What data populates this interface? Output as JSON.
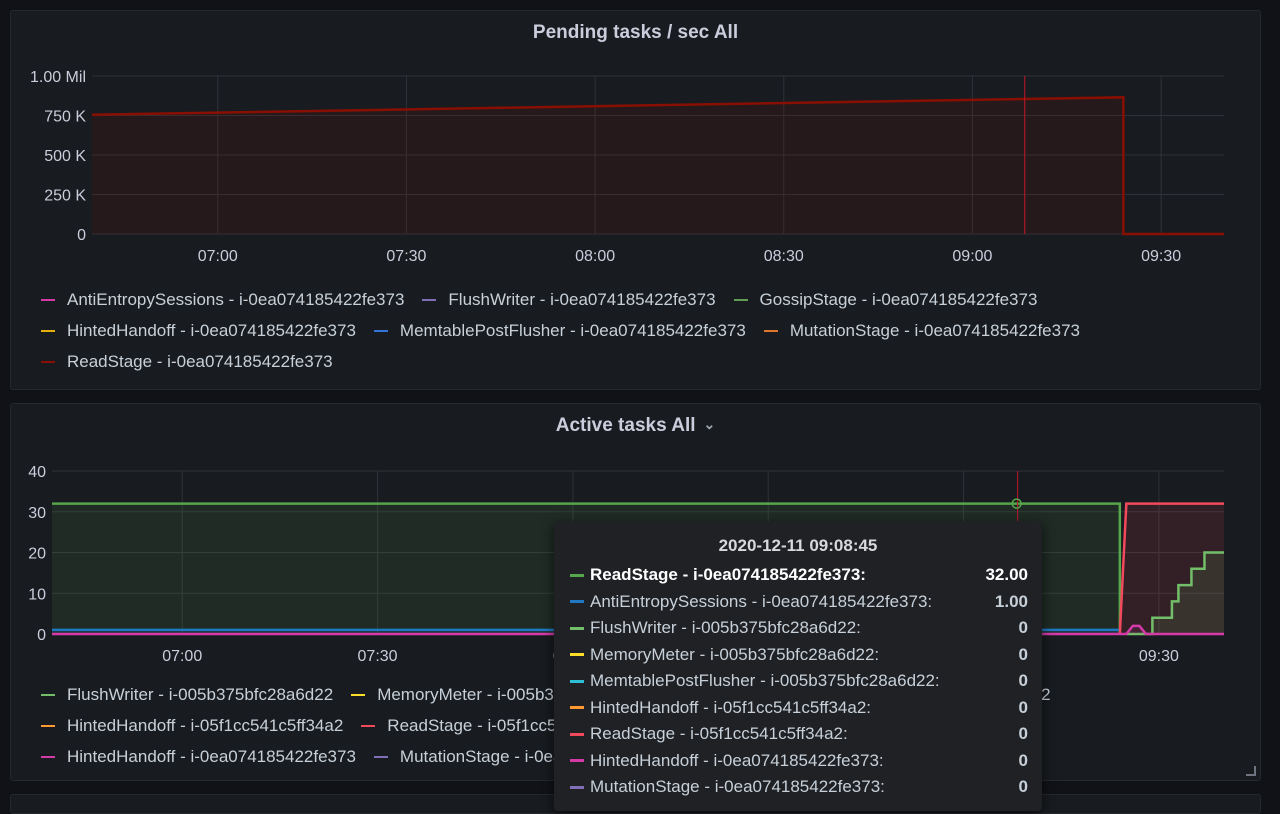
{
  "panel_pending": {
    "title": "Pending tasks / sec All",
    "legend": [
      {
        "label": "AntiEntropySessions - i-0ea074185422fe373",
        "color": "#d63aa9"
      },
      {
        "label": "FlushWriter - i-0ea074185422fe373",
        "color": "#806eb7"
      },
      {
        "label": "GossipStage - i-0ea074185422fe373",
        "color": "#629e51"
      },
      {
        "label": "HintedHandoff - i-0ea074185422fe373",
        "color": "#e5ac0e"
      },
      {
        "label": "MemtablePostFlusher - i-0ea074185422fe373",
        "color": "#3274d9"
      },
      {
        "label": "MutationStage - i-0ea074185422fe373",
        "color": "#e0752d"
      },
      {
        "label": "ReadStage - i-0ea074185422fe373",
        "color": "#890f02"
      }
    ]
  },
  "panel_active": {
    "title": "Active tasks All",
    "legend": [
      {
        "label": "FlushWriter - i-005b375bfc28a6d22",
        "color": "#73bf69"
      },
      {
        "label": "MemoryMeter - i-005b375bfc28a6d22",
        "color": "#fade2a"
      },
      {
        "label": "MemtablePostFlusher - i-005b375bfc28a6d22",
        "color": "#5794f2"
      },
      {
        "label": "HintedHandoff - i-05f1cc541c5ff34a2",
        "color": "#ff9830"
      },
      {
        "label": "ReadStage - i-05f1cc541c5ff34a2",
        "color": "#f2495c"
      },
      {
        "label": "ReadStage - i-0ea074185422fe373",
        "color": "#b877d9"
      },
      {
        "label": "HintedHandoff - i-0ea074185422fe373",
        "color": "#d63aa9"
      },
      {
        "label": "MutationStage - i-0ea074185422fe373",
        "color": "#806eb7"
      }
    ]
  },
  "tooltip": {
    "date": "2020-12-11 09:08:45",
    "rows": [
      {
        "name": "ReadStage - i-0ea074185422fe373:",
        "value": "32.00",
        "color": "#56a64b",
        "highlight": true
      },
      {
        "name": "AntiEntropySessions - i-0ea074185422fe373:",
        "value": "1.00",
        "color": "#1f78c1",
        "highlight": false
      },
      {
        "name": "FlushWriter - i-005b375bfc28a6d22:",
        "value": "0",
        "color": "#73bf69",
        "highlight": false
      },
      {
        "name": "MemoryMeter - i-005b375bfc28a6d22:",
        "value": "0",
        "color": "#fade2a",
        "highlight": false
      },
      {
        "name": "MemtablePostFlusher - i-005b375bfc28a6d22:",
        "value": "0",
        "color": "#2ebed6",
        "highlight": false
      },
      {
        "name": "HintedHandoff - i-05f1cc541c5ff34a2:",
        "value": "0",
        "color": "#ff9830",
        "highlight": false
      },
      {
        "name": "ReadStage - i-05f1cc541c5ff34a2:",
        "value": "0",
        "color": "#f2495c",
        "highlight": false
      },
      {
        "name": "HintedHandoff - i-0ea074185422fe373:",
        "value": "0",
        "color": "#d63aa9",
        "highlight": false
      },
      {
        "name": "MutationStage - i-0ea074185422fe373:",
        "value": "0",
        "color": "#806eb7",
        "highlight": false
      }
    ]
  },
  "chart_data": [
    {
      "type": "area",
      "title": "Pending tasks / sec All",
      "x_ticks": [
        "07:00",
        "07:30",
        "08:00",
        "08:30",
        "09:00",
        "09:30"
      ],
      "y_ticks": [
        "0",
        "250 K",
        "500 K",
        "750 K",
        "1.00 Mil"
      ],
      "ylim": [
        0,
        1000000
      ],
      "xlim": [
        "06:40",
        "09:40"
      ],
      "grid": true,
      "legend_position": "bottom",
      "series": [
        {
          "name": "ReadStage - i-0ea074185422fe373",
          "color": "#890f02",
          "x": [
            "06:40",
            "09:24",
            "09:24",
            "09:40"
          ],
          "y": [
            755000,
            865000,
            0,
            0
          ]
        }
      ],
      "crosshair_x": "09:08"
    },
    {
      "type": "area",
      "title": "Active tasks All",
      "x_ticks": [
        "07:00",
        "07:30",
        "08:00",
        "08:30",
        "09:00",
        "09:30"
      ],
      "y_ticks": [
        "0",
        "10",
        "20",
        "30",
        "40"
      ],
      "ylim": [
        0,
        40
      ],
      "xlim": [
        "06:40",
        "09:40"
      ],
      "grid": true,
      "legend_position": "bottom",
      "series": [
        {
          "name": "ReadStage - i-0ea074185422fe373",
          "color": "#56a64b",
          "x": [
            "06:40",
            "09:24",
            "09:24"
          ],
          "y": [
            32,
            32,
            0
          ]
        },
        {
          "name": "AntiEntropySessions - i-0ea074185422fe373",
          "color": "#1f78c1",
          "x": [
            "06:40",
            "09:24"
          ],
          "y": [
            1,
            1
          ]
        },
        {
          "name": "ReadStage - i-05f1cc541c5ff34a2",
          "color": "#f2495c",
          "x": [
            "09:24",
            "09:25",
            "09:40"
          ],
          "y": [
            0,
            32,
            32
          ]
        },
        {
          "name": "FlushWriter - i-005b375bfc28a6d22",
          "color": "#73bf69",
          "x": [
            "09:25",
            "09:29",
            "09:29",
            "09:32",
            "09:32",
            "09:33",
            "09:33",
            "09:35",
            "09:35",
            "09:37",
            "09:37",
            "09:40"
          ],
          "y": [
            0,
            0,
            4,
            4,
            8,
            8,
            12,
            12,
            16,
            16,
            20,
            20
          ]
        },
        {
          "name": "HintedHandoff - i-0ea074185422fe373",
          "color": "#d63aa9",
          "x": [
            "06:40",
            "09:25",
            "09:26",
            "09:27",
            "09:28",
            "09:40"
          ],
          "y": [
            0,
            0,
            2,
            2,
            0,
            0
          ]
        }
      ],
      "crosshair_x": "09:08"
    }
  ]
}
